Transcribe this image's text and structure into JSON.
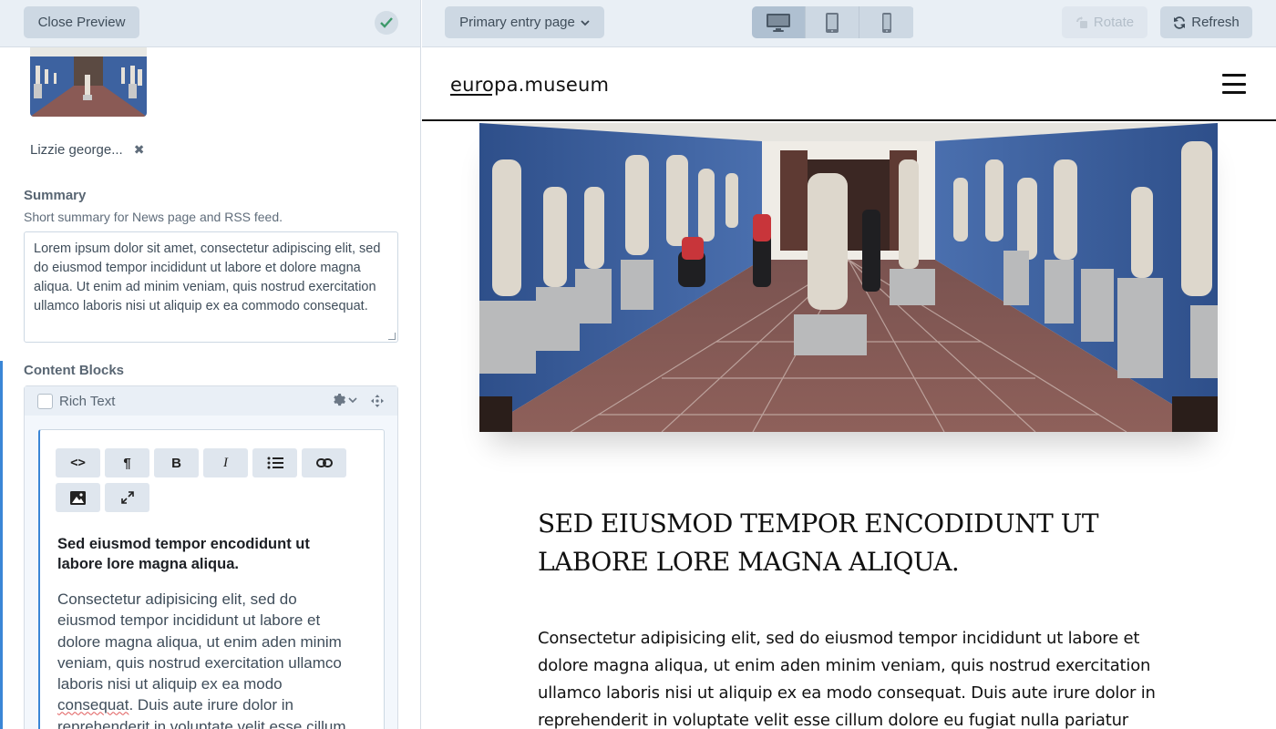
{
  "editor": {
    "close_preview_label": "Close Preview",
    "asset_name": "Lizzie george...",
    "summary_label": "Summary",
    "summary_help": "Short summary for News page and RSS feed.",
    "summary_text": "Lorem ipsum dolor sit amet, consectetur adipiscing elit, sed do eiusmod tempor incididunt ut labore et dolore magna aliqua. Ut enim ad minim veniam, quis nostrud exercitation ullamco laboris nisi ut aliquip ex ea commodo consequat.",
    "content_blocks_label": "Content Blocks",
    "block_type_label": "Rich Text",
    "toolbar": [
      "code",
      "paragraph",
      "bold",
      "italic",
      "list",
      "link",
      "image",
      "fullscreen"
    ],
    "rte_heading": "Sed eiusmod tempor encodidunt ut labore lore magna aliqua.",
    "rte_para_start": "Consectetur adipisicing elit, sed do eiusmod tempor incididunt ut labore et dolore magna aliqua, ut enim aden minim veniam, quis nostrud exercitation ullamco laboris nisi ut aliquip ex ea modo ",
    "rte_para_misspelled": "consequat",
    "rte_para_end": ". Duis aute irure dolor in reprehenderit in voluptate velit esse cillum"
  },
  "preview": {
    "entry_select_label": "Primary entry page",
    "devices": [
      "desktop",
      "tablet",
      "phone"
    ],
    "active_device": "desktop",
    "rotate_label": "Rotate",
    "refresh_label": "Refresh"
  },
  "site": {
    "logo": "europa.museum",
    "article_title": "SED EIUSMOD TEMPOR ENCODIDUNT UT LABORE LORE MAGNA ALIQUA.",
    "article_body": "Consectetur adipisicing elit, sed do eiusmod tempor incididunt ut labore et dolore magna aliqua, ut enim aden minim veniam, quis nostrud exercitation ullamco laboris nisi ut aliquip ex ea modo consequat. Duis aute irure dolor in reprehenderit in voluptate velit esse cillum dolore eu fugiat nulla pariatur excepteur sint"
  },
  "colors": {
    "accent": "#3a86d6",
    "header_bg": "#e9eff5",
    "button_bg": "#cdd8e3",
    "gallery_wall": "#3d62a0",
    "gallery_floor": "#8a5a55"
  }
}
